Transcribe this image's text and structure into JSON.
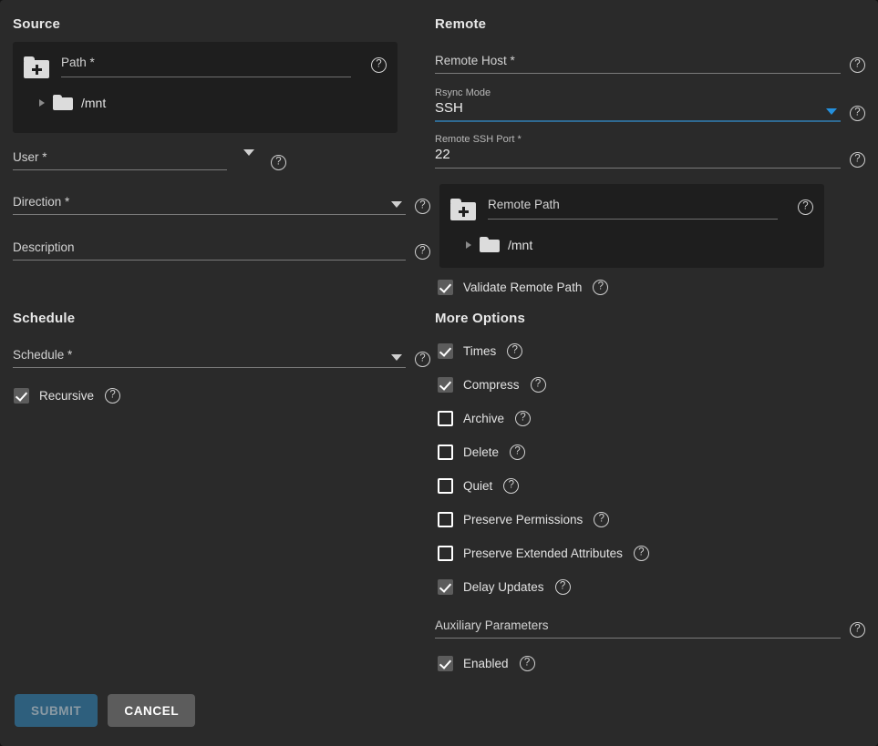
{
  "source": {
    "title": "Source",
    "path_picker": {
      "add_label": "Path *",
      "tree_item": "/mnt"
    },
    "user": {
      "label": "User *"
    },
    "direction": {
      "label": "Direction *"
    },
    "description": {
      "label": "Description"
    }
  },
  "schedule": {
    "title": "Schedule",
    "schedule_field": {
      "label": "Schedule *"
    },
    "recursive": {
      "label": "Recursive",
      "checked": true
    }
  },
  "remote": {
    "title": "Remote",
    "remote_host": {
      "label": "Remote Host *"
    },
    "rsync_mode": {
      "label": "Rsync Mode",
      "value": "SSH"
    },
    "remote_ssh_port": {
      "label": "Remote SSH Port *",
      "value": "22"
    },
    "path_picker": {
      "add_label": "Remote Path",
      "tree_item": "/mnt"
    },
    "validate_remote_path": {
      "label": "Validate Remote Path",
      "checked": true
    }
  },
  "more_options": {
    "title": "More Options",
    "checkboxes": [
      {
        "label": "Times",
        "checked": true
      },
      {
        "label": "Compress",
        "checked": true
      },
      {
        "label": "Archive",
        "checked": false
      },
      {
        "label": "Delete",
        "checked": false
      },
      {
        "label": "Quiet",
        "checked": false
      },
      {
        "label": "Preserve Permissions",
        "checked": false
      },
      {
        "label": "Preserve Extended Attributes",
        "checked": false
      },
      {
        "label": "Delay Updates",
        "checked": true
      }
    ],
    "auxiliary_parameters": {
      "label": "Auxiliary Parameters"
    },
    "enabled": {
      "label": "Enabled",
      "checked": true
    }
  },
  "footer": {
    "submit_label": "SUBMIT",
    "cancel_label": "CANCEL"
  },
  "icons": {
    "help": "?",
    "folder_add": "folder-add-icon",
    "folder": "folder-icon",
    "expand": "chevron-right-icon",
    "dropdown": "chevron-down-icon"
  },
  "colors": {
    "page_bg": "#2a2a2a",
    "panel_bg": "#1e1e1e",
    "accent_blue": "#2490dd",
    "focus_underline": "#2f6a93",
    "submit_bg": "#2e5f7d",
    "cancel_bg": "#5c5c5c"
  }
}
